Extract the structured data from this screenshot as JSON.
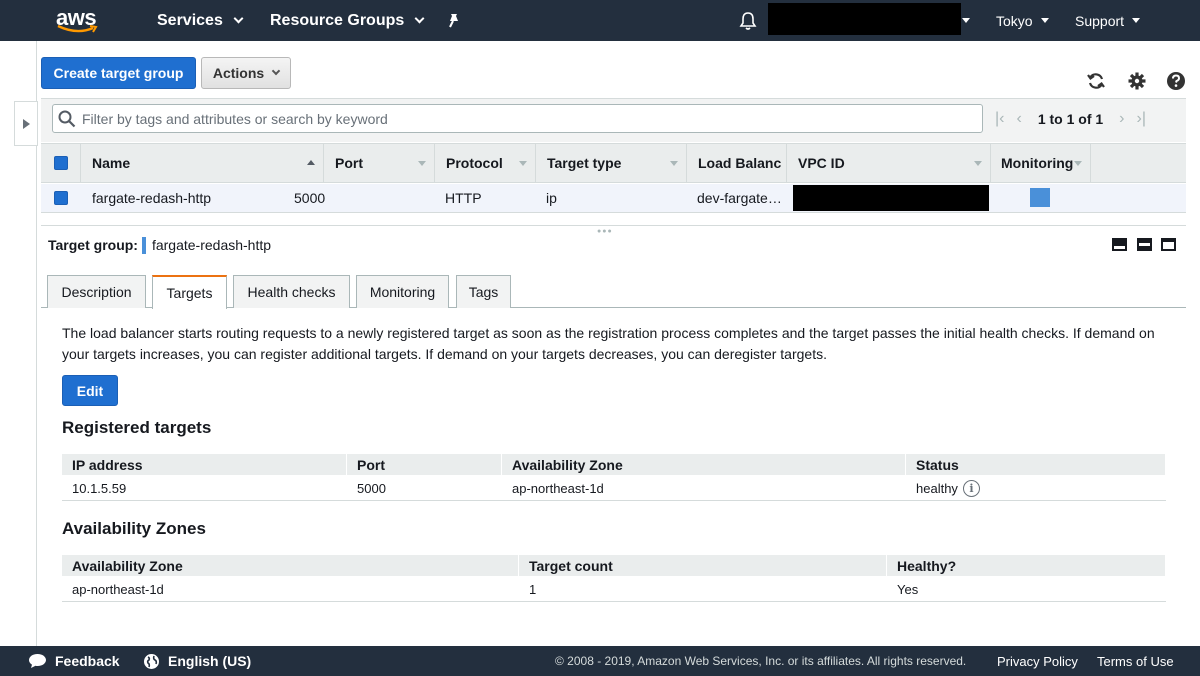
{
  "nav": {
    "logo": "aws",
    "services": "Services",
    "resource_groups": "Resource Groups",
    "region": "Tokyo",
    "support": "Support"
  },
  "toolbar": {
    "create_label": "Create target group",
    "actions_label": "Actions"
  },
  "search": {
    "placeholder": "Filter by tags and attributes or search by keyword"
  },
  "pager": {
    "range_text": "1 to 1 of 1"
  },
  "table": {
    "columns": [
      "Name",
      "Port",
      "Protocol",
      "Target type",
      "Load Balanc",
      "VPC ID",
      "Monitoring"
    ],
    "rows": [
      {
        "name": "fargate-redash-http",
        "port": "5000",
        "protocol": "HTTP",
        "target_type": "ip",
        "load_balancer": "dev-fargate…"
      }
    ]
  },
  "detail": {
    "label": "Target group:",
    "name": "fargate-redash-http",
    "tabs": [
      "Description",
      "Targets",
      "Health checks",
      "Monitoring",
      "Tags"
    ],
    "active_tab": "Targets",
    "description": "The load balancer starts routing requests to a newly registered target as soon as the registration process completes and the target passes the initial health checks. If demand on your targets increases, you can register additional targets. If demand on your targets decreases, you can deregister targets.",
    "edit_label": "Edit",
    "registered_title": "Registered targets",
    "registered_columns": [
      "IP address",
      "Port",
      "Availability Zone",
      "Status"
    ],
    "registered_rows": [
      {
        "ip": "10.1.5.59",
        "port": "5000",
        "zone": "ap-northeast-1d",
        "status": "healthy"
      }
    ],
    "az_title": "Availability Zones",
    "az_columns": [
      "Availability Zone",
      "Target count",
      "Healthy?"
    ],
    "az_rows": [
      {
        "zone": "ap-northeast-1d",
        "count": "1",
        "healthy": "Yes"
      }
    ]
  },
  "footer": {
    "feedback": "Feedback",
    "language": "English (US)",
    "copyright": "© 2008 - 2019, Amazon Web Services, Inc. or its affiliates. All rights reserved.",
    "privacy": "Privacy Policy",
    "terms": "Terms of Use"
  },
  "colors": {
    "nav_bg": "#232f3e",
    "primary": "#1f6fd0",
    "active_tab": "#ec7211",
    "monitor_swatch": "#4a90d9"
  }
}
